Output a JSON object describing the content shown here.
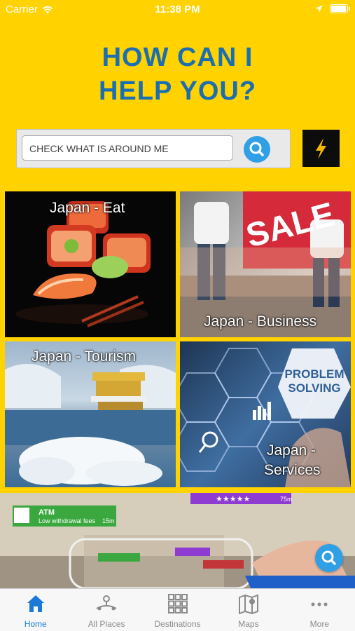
{
  "status_bar": {
    "carrier": "Carrier",
    "time": "11:38 PM"
  },
  "header": {
    "title_line1": "HOW CAN I",
    "title_line2": "HELP YOU?"
  },
  "search": {
    "placeholder": "CHECK WHAT IS AROUND ME"
  },
  "tiles": [
    {
      "label": "Japan - Eat"
    },
    {
      "label": "Japan - Business",
      "sign": "SALE"
    },
    {
      "label": "Japan - Tourism"
    },
    {
      "label_line1": "Japan -",
      "label_line2": "Services",
      "badge_line1": "PROBLEM",
      "badge_line2": "SOLVING"
    }
  ],
  "ar_banner": {
    "atm_title": "ATM",
    "atm_sub": "Low withdrawal fees",
    "atm_distance": "15m",
    "top_distance": "75m",
    "stars": "★★★★★"
  },
  "tabbar": {
    "items": [
      {
        "label": "Home"
      },
      {
        "label": "All Places"
      },
      {
        "label": "Destinations"
      },
      {
        "label": "Maps"
      },
      {
        "label": "More"
      }
    ]
  },
  "colors": {
    "background": "#FFD200",
    "title": "#1b6fb1",
    "accent": "#2f9fe6",
    "tab_active": "#1b7ad6"
  }
}
